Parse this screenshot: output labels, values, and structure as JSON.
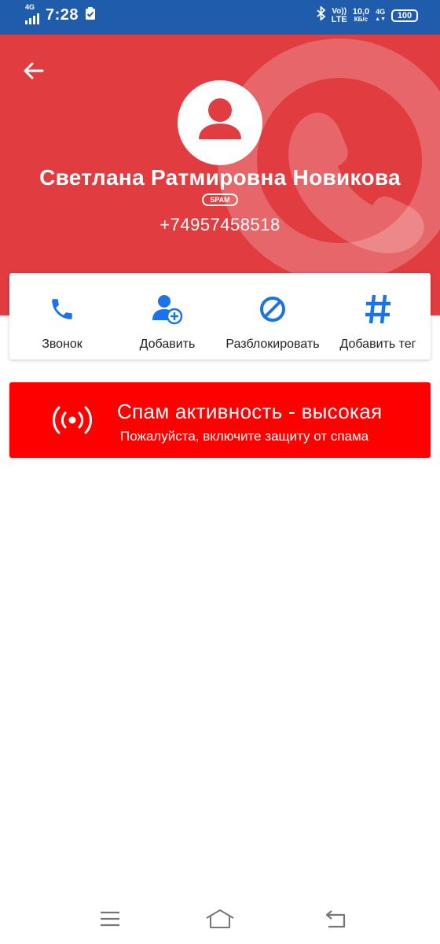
{
  "status_bar": {
    "network": "4G",
    "time": "7:28",
    "volte": "Vo))",
    "lte": "LTE",
    "speed_value": "10,0",
    "speed_unit": "КБ/с",
    "network_right": "4G",
    "battery": "100"
  },
  "header": {
    "contact_name": "Светлана Ратмировна Новикова",
    "badge": "SPAM",
    "phone_number": "+74957458518",
    "color": "#e13c3f"
  },
  "actions": [
    {
      "label": "Звонок",
      "icon": "phone-icon"
    },
    {
      "label": "Добавить",
      "icon": "add-contact-icon"
    },
    {
      "label": "Разблокировать",
      "icon": "unblock-icon"
    },
    {
      "label": "Добавить тег",
      "icon": "hashtag-icon"
    }
  ],
  "spam_alert": {
    "title": "Спам активность - высокая",
    "subtitle": "Пожалуйста, включите защиту от спама",
    "color": "#ff0000",
    "icon": "broadcast-icon"
  },
  "nav_bar": {
    "buttons": [
      "menu-icon",
      "home-icon",
      "back-icon"
    ]
  },
  "accent_color": "#1a73e8"
}
